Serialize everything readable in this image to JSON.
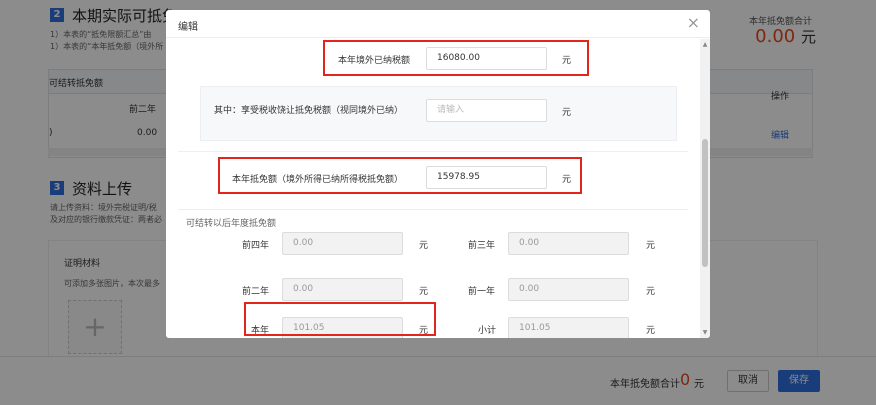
{
  "page": {
    "section2": {
      "num": "2",
      "title": "本期实际可抵免",
      "note1": "1）本表的“抵免限额汇总”由",
      "note2": "1）本表的“本年抵免额（境外所"
    },
    "section3": {
      "num": "3",
      "title": "资料上传",
      "note1": "请上传资料：境外完税证明/税",
      "note2": "及对应的银行缴款凭证：两者必"
    },
    "total_label": "本年抵免额合计",
    "total_value": "0.00",
    "total_unit": "元",
    "table": {
      "carry_header": "可结转抵免额",
      "col_prev2": "前二年",
      "col_op": "操作",
      "row_value": "0.00",
      "row_left": ")",
      "row_link": "编辑"
    },
    "evidence": {
      "title": "证明材料",
      "hint": "可添加多张图片，本次最多",
      "upload_icon": "plus-icon"
    }
  },
  "footer": {
    "label": "本年抵免额合计",
    "value": "0",
    "unit": "元",
    "cancel": "取消",
    "save": "保存"
  },
  "modal": {
    "title": "编辑",
    "close_icon": "close-icon",
    "foreign_tax_paid": {
      "label": "本年境外已纳税额",
      "value": "16080.00",
      "unit": "元"
    },
    "sparing_credit": {
      "label": "其中：享受税收饶让抵免税额（视同境外已纳）",
      "placeholder": "请输入",
      "unit": "元"
    },
    "current_credit": {
      "label": "本年抵免额（境外所得已纳所得税抵免额）",
      "value": "15978.95",
      "unit": "元"
    },
    "carryforward": {
      "title": "可结转以后年度抵免额",
      "items": [
        {
          "label": "前四年",
          "value": "0.00",
          "unit": "元"
        },
        {
          "label": "前三年",
          "value": "0.00",
          "unit": "元"
        },
        {
          "label": "前二年",
          "value": "0.00",
          "unit": "元"
        },
        {
          "label": "前一年",
          "value": "0.00",
          "unit": "元"
        },
        {
          "label": "本年",
          "value": "101.05",
          "unit": "元"
        },
        {
          "label": "小计",
          "value": "101.05",
          "unit": "元"
        }
      ]
    },
    "highlight_color": "#e2261b"
  }
}
